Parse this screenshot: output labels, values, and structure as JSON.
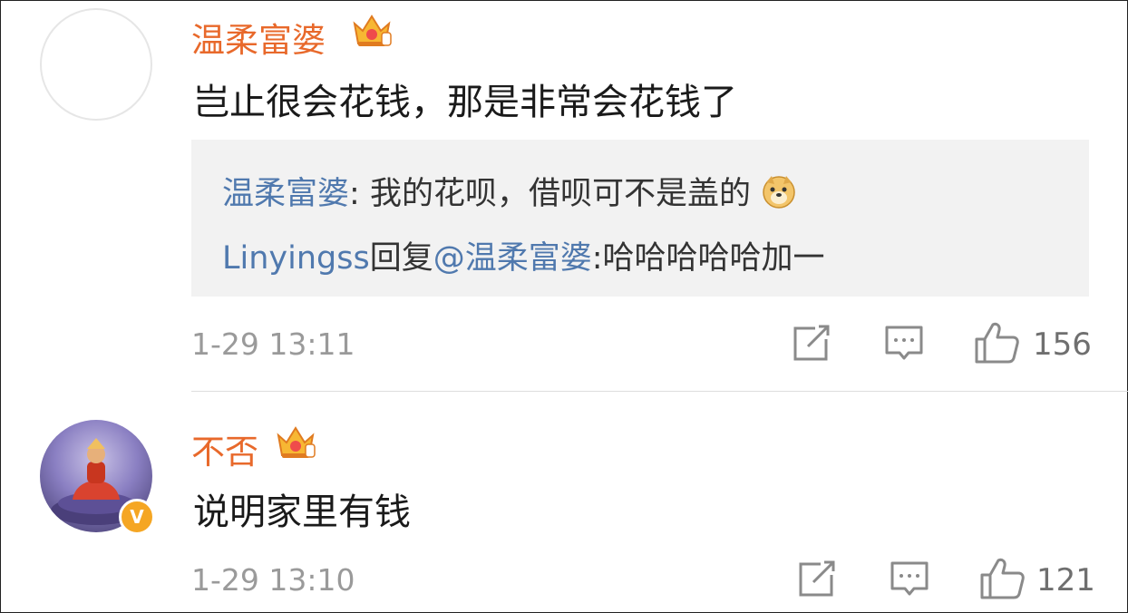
{
  "comments": [
    {
      "user": "温柔富婆",
      "text": "岂止很会花钱，那是非常会花钱了",
      "replies": [
        {
          "author": "温柔富婆",
          "sep": ": ",
          "text": "我的花呗，借呗可不是盖的"
        },
        {
          "author": "Linyingss",
          "reply_word": "回复",
          "mention": "@温柔富婆",
          "sep": ":",
          "text": "哈哈哈哈哈加一"
        }
      ],
      "time": "1-29 13:11",
      "likes": "156"
    },
    {
      "user": "不否",
      "text": "说明家里有钱",
      "verified_badge": "V",
      "time": "1-29 13:10",
      "likes": "121"
    }
  ],
  "icons": [
    "crown-icon",
    "doge-emoji",
    "repost-icon",
    "comment-icon",
    "like-icon",
    "verified-icon"
  ],
  "colors": {
    "username": "#e8692b",
    "link": "#5079ae",
    "meta": "#9a9a9a",
    "quote_bg": "#f2f2f2",
    "badge": "#f5a623"
  }
}
